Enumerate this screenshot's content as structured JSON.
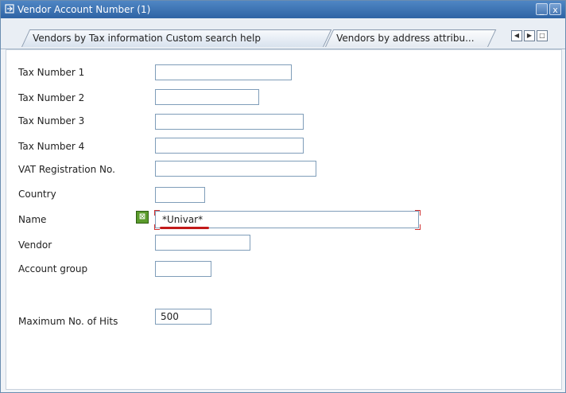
{
  "window": {
    "title": "Vendor Account Number (1)",
    "minimize_symbol": "_",
    "close_symbol": "x"
  },
  "tabs": [
    {
      "label": "Vendors by Tax information Custom search help",
      "active": true
    },
    {
      "label": "Vendors by address attribu...",
      "active": false
    }
  ],
  "tab_nav": {
    "prev": "◀",
    "next": "▶",
    "list": "□"
  },
  "form": {
    "tax_number_1": {
      "label": "Tax Number 1",
      "value": ""
    },
    "tax_number_2": {
      "label": "Tax Number 2",
      "value": ""
    },
    "tax_number_3": {
      "label": "Tax Number 3",
      "value": ""
    },
    "tax_number_4": {
      "label": "Tax Number 4",
      "value": ""
    },
    "vat_registration": {
      "label": "VAT Registration No.",
      "value": ""
    },
    "country": {
      "label": "Country",
      "value": ""
    },
    "name": {
      "label": "Name",
      "value": "*Univar*"
    },
    "vendor": {
      "label": "Vendor",
      "value": ""
    },
    "account_group": {
      "label": "Account group",
      "value": ""
    },
    "max_hits": {
      "label": "Maximum No. of Hits",
      "value": "500"
    }
  },
  "icons": {
    "title": "window-app-icon",
    "multiple_selection": "multiple-selection-icon"
  },
  "colors": {
    "title_bar": "#2e63a4",
    "annotation": "#c21a1a",
    "select_button": "#5b9b2b"
  }
}
